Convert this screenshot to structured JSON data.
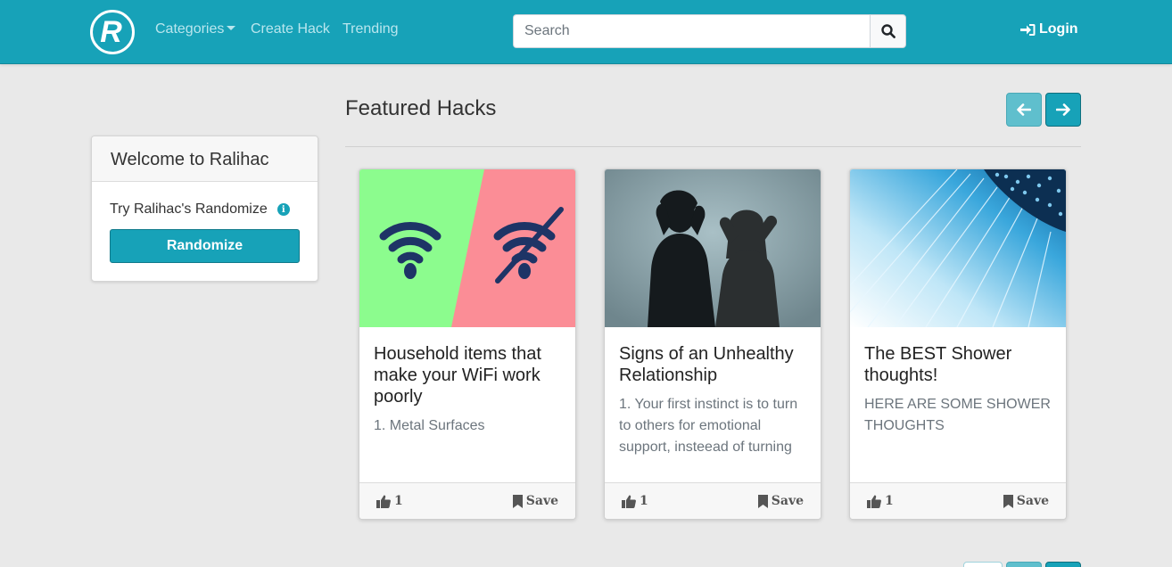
{
  "nav": {
    "logo_letter": "R",
    "categories_label": "Categories",
    "create_label": "Create Hack",
    "trending_label": "Trending",
    "search_placeholder": "Search",
    "login_label": "Login"
  },
  "sidebar": {
    "title": "Welcome to Ralihac",
    "try_text": "Try Ralihac's Randomize",
    "info_glyph": "i",
    "button_label": "Randomize"
  },
  "featured": {
    "title": "Featured Hacks",
    "cards": [
      {
        "title": "Household items that make your WiFi work poorly",
        "text": "1. Metal Surfaces",
        "likes": "1",
        "save_label": "Save"
      },
      {
        "title": "Signs of an Unhealthy Relationship",
        "text": "1. Your first instinct is to turn to others for emotional support, insteead of turning",
        "likes": "1",
        "save_label": "Save"
      },
      {
        "title": "The BEST Shower thoughts!",
        "text": "HERE ARE SOME SHOWER THOUGHTS",
        "likes": "1",
        "save_label": "Save"
      }
    ]
  },
  "colors": {
    "primary": "#17a2b8",
    "wifi_green": "#8cfc8e",
    "wifi_red": "#fb8d96",
    "wifi_icon": "#1e3466"
  }
}
